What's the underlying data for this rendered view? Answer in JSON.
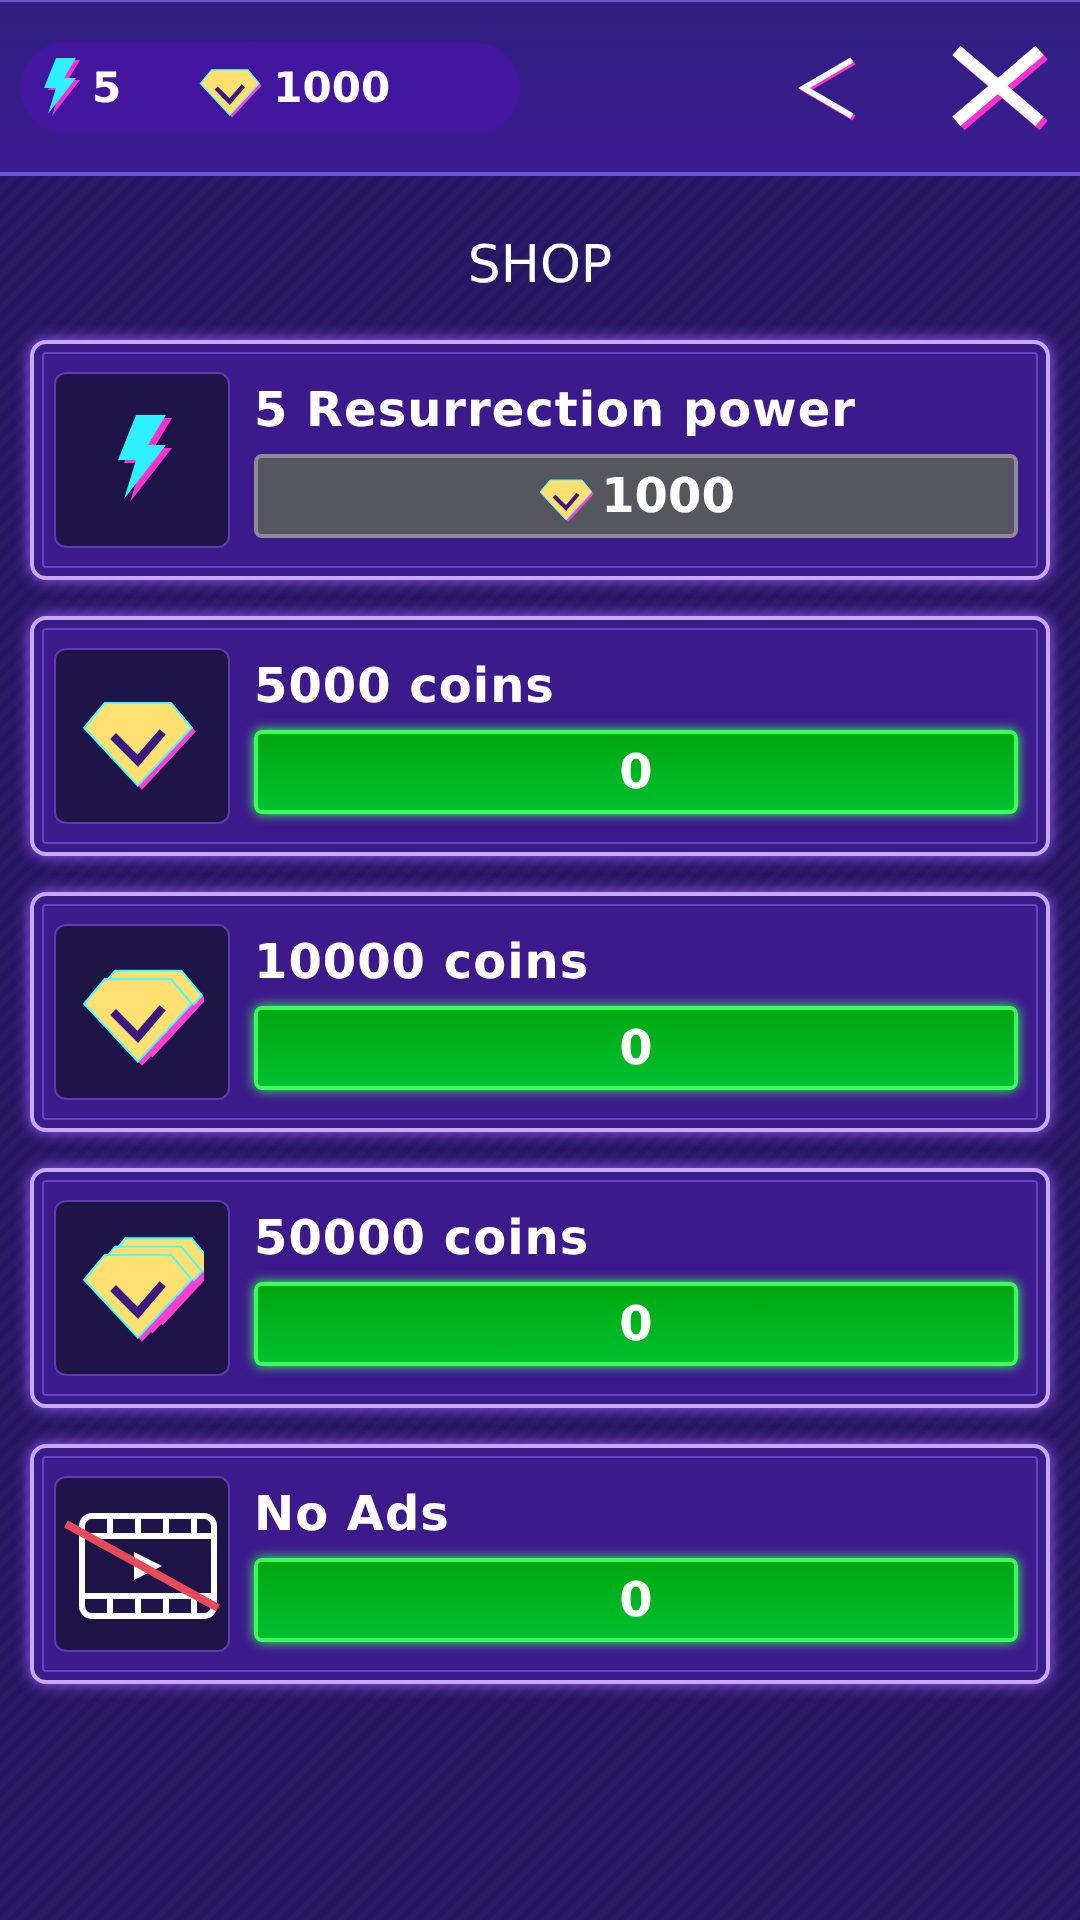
{
  "header": {
    "power": "5",
    "gems": "1000"
  },
  "title": "SHOP",
  "items": [
    {
      "kind": "power",
      "name": "5 Resurrection power",
      "price": "1000",
      "gem_icon": true,
      "disabled": true
    },
    {
      "kind": "gems_small",
      "name": "5000 coins",
      "price": "0",
      "disabled": false
    },
    {
      "kind": "gems_medium",
      "name": "10000 coins",
      "price": "0",
      "disabled": false
    },
    {
      "kind": "gems_large",
      "name": "50000 coins",
      "price": "0",
      "disabled": false
    },
    {
      "kind": "no_ads",
      "name": "No Ads",
      "price": "0",
      "disabled": false
    }
  ]
}
